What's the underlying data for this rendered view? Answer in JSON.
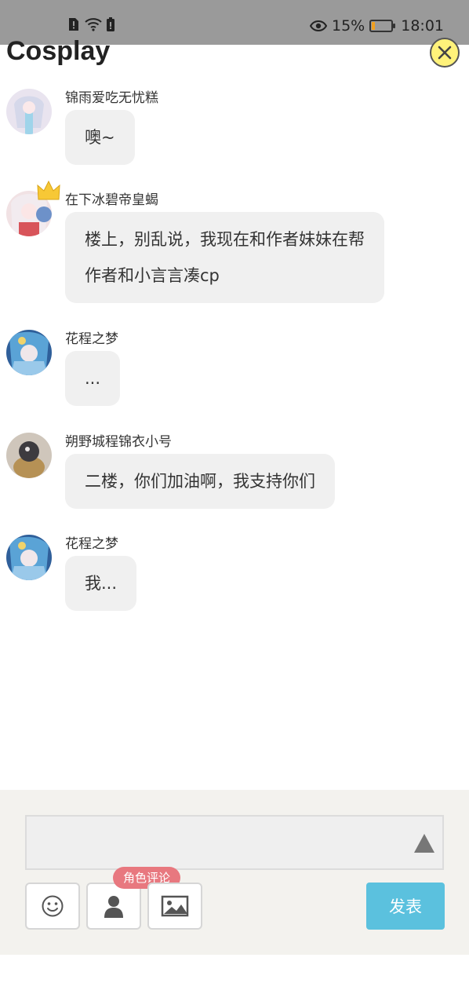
{
  "status_bar": {
    "battery_percent": "15%",
    "battery_level": 0.15,
    "time": "18:01",
    "icons": [
      "alert-icon",
      "wifi-icon",
      "battery-small-icon",
      "eye-icon",
      "battery-icon"
    ]
  },
  "header": {
    "title": "Cosplay",
    "close_icon": "close-icon"
  },
  "messages": [
    {
      "username": "锦雨爱吃无忧糕",
      "lines": [
        "噢~"
      ],
      "has_crown": false
    },
    {
      "username": "在下冰碧帝皇蝎",
      "lines": [
        "楼上，别乱说，我现在和作者妹妹在帮",
        "作者和小言言凑cp"
      ],
      "has_crown": true
    },
    {
      "username": "花程之梦",
      "lines": [
        "..."
      ],
      "has_crown": false
    },
    {
      "username": "朔野城程锦衣小号",
      "lines": [
        "二楼，你们加油啊，我支持你们"
      ],
      "has_crown": false
    },
    {
      "username": "花程之梦",
      "lines": [
        "我..."
      ],
      "has_crown": false
    }
  ],
  "composer": {
    "input_value": "",
    "role_tag": "角色评论",
    "submit_label": "发表",
    "tools": [
      "emoji-icon",
      "person-icon",
      "image-icon"
    ]
  },
  "colors": {
    "status_bar_bg": "#9a9a9a",
    "bubble_bg": "#f0f0f0",
    "submit_bg": "#5bc1de",
    "role_tag_bg": "#e8787f",
    "close_bg": "#fff27a"
  }
}
